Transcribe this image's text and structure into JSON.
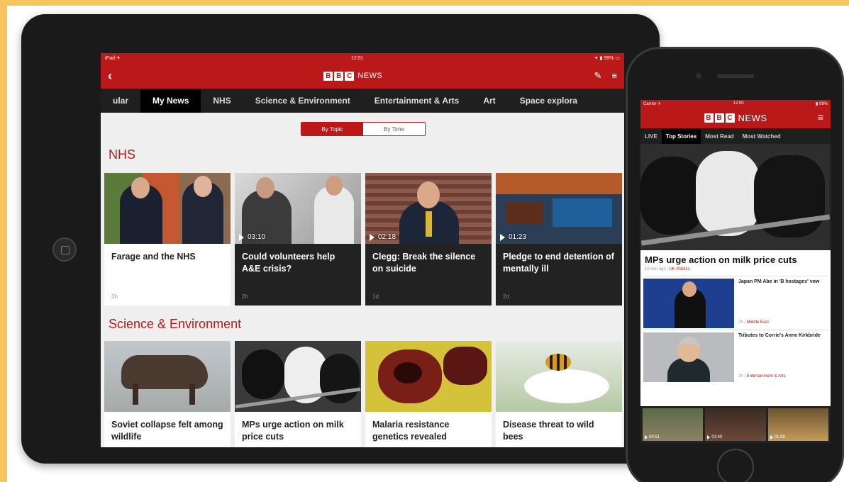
{
  "tablet": {
    "status": {
      "left": "iPad ✈",
      "center": "12:01",
      "right": "✦ ▮ 99% ▭"
    },
    "brand": {
      "logo_letters": [
        "B",
        "B",
        "C"
      ],
      "news": "NEWS"
    },
    "icons": {
      "back": "back-chevron-icon",
      "edit": "pencil-icon",
      "menu": "hamburger-menu-icon"
    },
    "tabs": [
      "ular",
      "My News",
      "NHS",
      "Science & Environment",
      "Entertainment & Arts",
      "Art",
      "Space explora"
    ],
    "active_tab": "My News",
    "toggle": {
      "by_topic": "By Topic",
      "by_time": "By Time"
    },
    "sections": [
      {
        "title": "NHS",
        "cards": [
          {
            "headline": "Farage and the NHS",
            "meta": "3h",
            "duration": "",
            "style": "light"
          },
          {
            "headline": "Could volunteers help A&E crisis?",
            "meta": "2h",
            "duration": "03:10",
            "style": "dark"
          },
          {
            "headline": "Clegg: Break the silence on suicide",
            "meta": "1d",
            "duration": "02:18",
            "style": "dark"
          },
          {
            "headline": "Pledge to end detention of mentally ill",
            "meta": "2d",
            "duration": "01:23",
            "style": "dark"
          }
        ]
      },
      {
        "title": "Science & Environment",
        "cards": [
          {
            "headline": "Soviet collapse felt among wildlife"
          },
          {
            "headline": "MPs urge action on milk price cuts"
          },
          {
            "headline": "Malaria resistance genetics revealed"
          },
          {
            "headline": "Disease threat to wild bees"
          }
        ]
      }
    ]
  },
  "phone": {
    "status": {
      "left": "Carrier ✈",
      "center": "12:00",
      "right": "▮ 99%"
    },
    "brand": {
      "logo_letters": [
        "B",
        "B",
        "C"
      ],
      "news": "NEWS"
    },
    "icons": {
      "menu": "hamburger-menu-icon"
    },
    "tabs": [
      "LIVE",
      "Top Stories",
      "Most Read",
      "Most Watched"
    ],
    "active_tab": "Top Stories",
    "hero": {
      "headline": "MPs urge action on milk price cuts",
      "time": "10 min ago",
      "category": "UK Politics"
    },
    "items": [
      {
        "title": "Japan PM Abe in 'B hostages' vow",
        "time": "2h",
        "category": "Middle East"
      },
      {
        "title": "Tributes to Corrie's Anne Kirkbride",
        "time": "3h",
        "category": "Entertainment & Arts"
      }
    ],
    "videos": [
      {
        "duration": "00:51"
      },
      {
        "duration": "01:40"
      },
      {
        "duration": "01:09"
      }
    ]
  },
  "colors": {
    "accent": "#bb1919",
    "frame_bg": "#f6c560",
    "device": "#1a1a1a"
  }
}
